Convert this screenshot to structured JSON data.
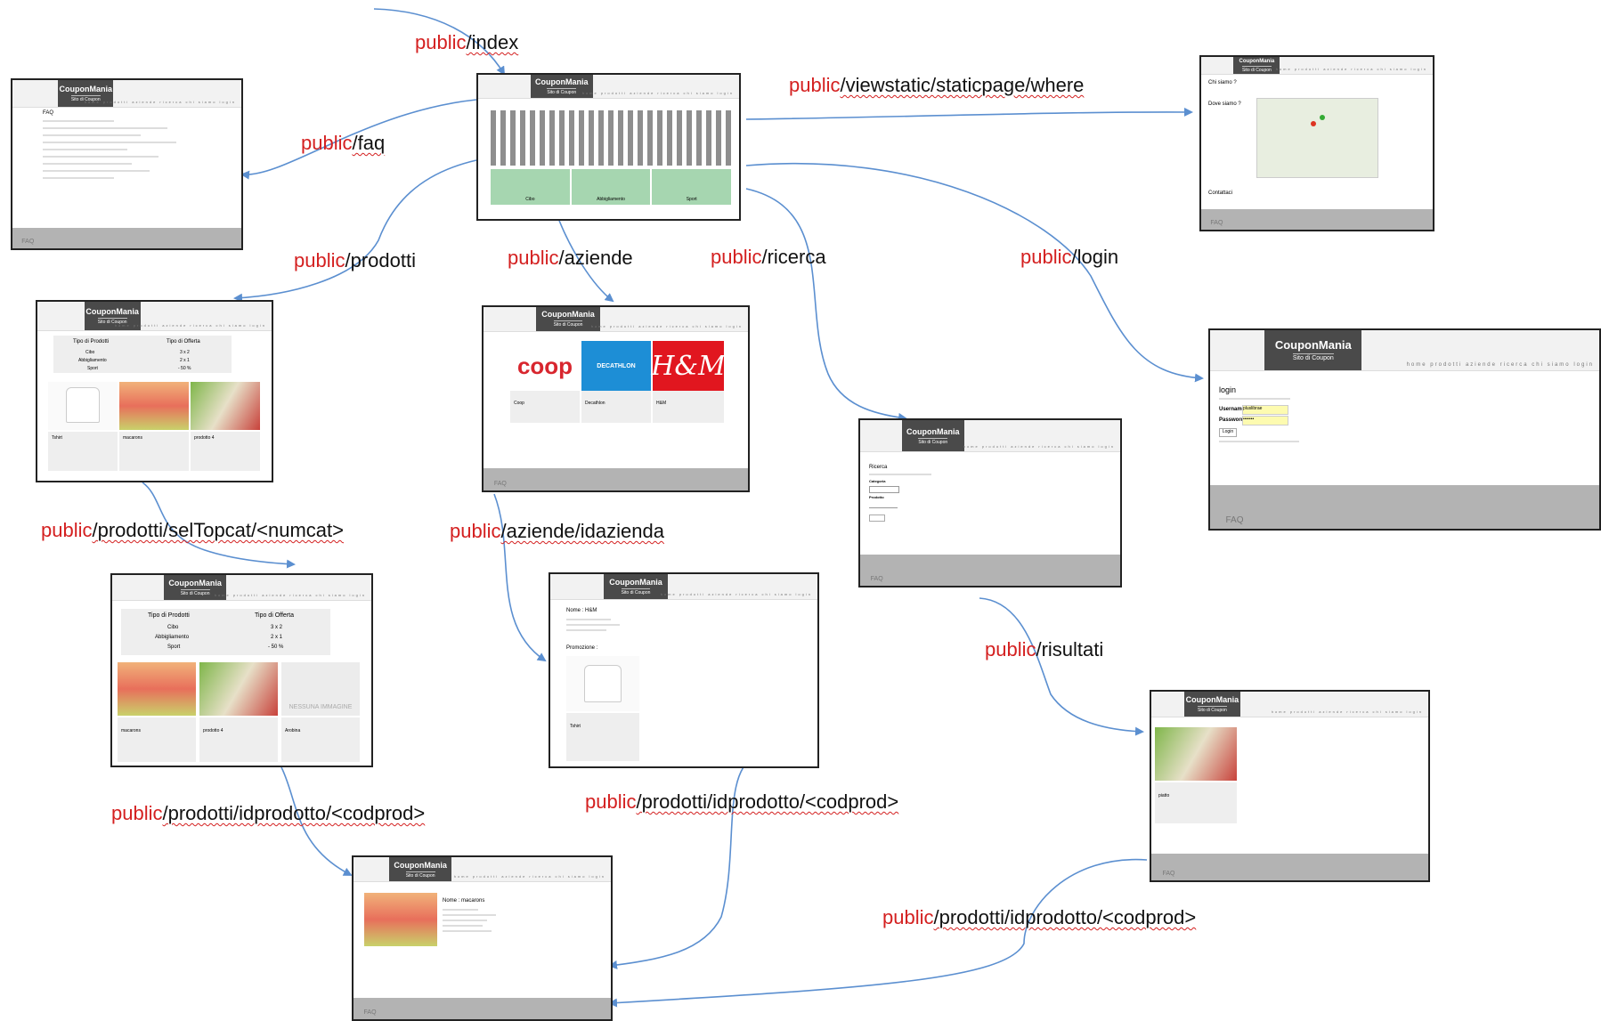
{
  "edges": [
    {
      "prefix": "public",
      "path": "/index"
    },
    {
      "prefix": "public",
      "path": "/faq"
    },
    {
      "prefix": "public",
      "path": "/viewstatic/staticpage/where"
    },
    {
      "prefix": "public",
      "path": "/prodotti"
    },
    {
      "prefix": "public",
      "path": "/aziende"
    },
    {
      "prefix": "public",
      "path": "/ricerca"
    },
    {
      "prefix": "public",
      "path": "/login"
    },
    {
      "prefix": "public",
      "path": "/prodotti/selTopcat/<numcat>"
    },
    {
      "prefix": "public",
      "path": "/aziende/idazienda"
    },
    {
      "prefix": "public",
      "path": "/risultati"
    },
    {
      "prefix": "public",
      "path": "/prodotti/idprodotto/<codprod>"
    },
    {
      "prefix": "public",
      "path": "/prodotti/idprodotto/<codprod>"
    },
    {
      "prefix": "public",
      "path": "/prodotti/idprodotto/<codprod>"
    }
  ],
  "site": {
    "brand": "CouponMania",
    "tagline": "Sito di Coupon",
    "footer": "FAQ"
  },
  "nav_items": "home  prodotti  aziende  ricerca  chi siamo  login",
  "home": {
    "tiles": [
      "Cibo",
      "Abbigliamento",
      "Sport"
    ]
  },
  "faq": {
    "heading": "FAQ"
  },
  "where": {
    "q1": "Chi siamo ?",
    "q2": "Dove siamo ?",
    "contact": "Contattaci"
  },
  "prodotti": {
    "th1": "Tipo di Prodotti",
    "th2": "Tipo di Offerta",
    "rows": [
      [
        "Cibo",
        "3 x 2"
      ],
      [
        "Abbigliamento",
        "2 x 1"
      ],
      [
        "Sport",
        "- 50 %"
      ]
    ],
    "cards": [
      "Tshirt",
      "macarons",
      "prodotto 4"
    ]
  },
  "aziende": {
    "logos": [
      "coop",
      "DECATHLON",
      "H&M"
    ],
    "names": [
      "Coop",
      "Decathlon",
      "H&M"
    ]
  },
  "login": {
    "title": "login",
    "user_label": "Username",
    "pass_label": "Password",
    "user_value": "pluslibrae",
    "pass_value": "•••••••",
    "button": "Login"
  },
  "ricerca": {
    "title": "Ricerca",
    "cat_label": "Categoria",
    "prod_label": "Prodotto"
  },
  "seltop": {
    "cards": [
      "macarons",
      "prodotto 4",
      "Arobina"
    ],
    "noimg": "NESSUNA IMMAGINE"
  },
  "azienda": {
    "name": "Nome : H&M",
    "promo": "Promozione :",
    "card": "Tshirt"
  },
  "risultati": {
    "card": "piatto"
  },
  "dettaglio": {
    "name": "Nome : macarons"
  }
}
